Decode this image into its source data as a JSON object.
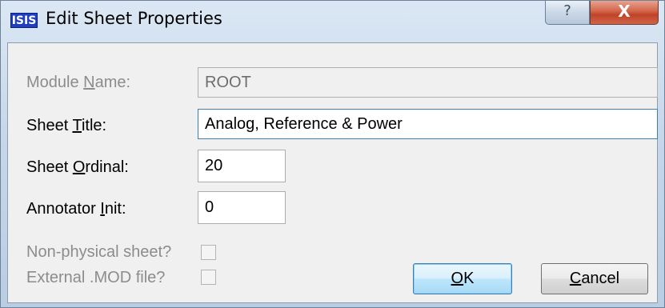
{
  "window": {
    "app_icon_text": "ISIS",
    "title": "Edit Sheet Properties",
    "help_glyph": "?",
    "close_glyph": "X"
  },
  "form": {
    "module_name": {
      "label_pre": "Module ",
      "label_accel": "N",
      "label_post": "ame:",
      "value": "ROOT",
      "enabled": false
    },
    "sheet_title": {
      "label_pre": "Sheet ",
      "label_accel": "T",
      "label_post": "itle:",
      "value": "Analog, Reference & Power"
    },
    "sheet_ordinal": {
      "label_pre": "Sheet ",
      "label_accel": "O",
      "label_post": "rdinal:",
      "value": "20"
    },
    "annotator_init": {
      "label_pre": "Annotator ",
      "label_accel": "I",
      "label_post": "nit:",
      "value": "0"
    },
    "non_physical": {
      "label": "Non-physical sheet?",
      "checked": false,
      "enabled": false
    },
    "external_mod": {
      "label": "External .MOD file?",
      "checked": false,
      "enabled": false
    }
  },
  "buttons": {
    "ok": {
      "accel": "O",
      "rest": "K"
    },
    "cancel": {
      "accel": "C",
      "rest": "ancel"
    }
  },
  "colors": {
    "accent_border": "#3c7fb1",
    "close_red": "#c04326",
    "disabled_text": "#8c8c8c"
  }
}
